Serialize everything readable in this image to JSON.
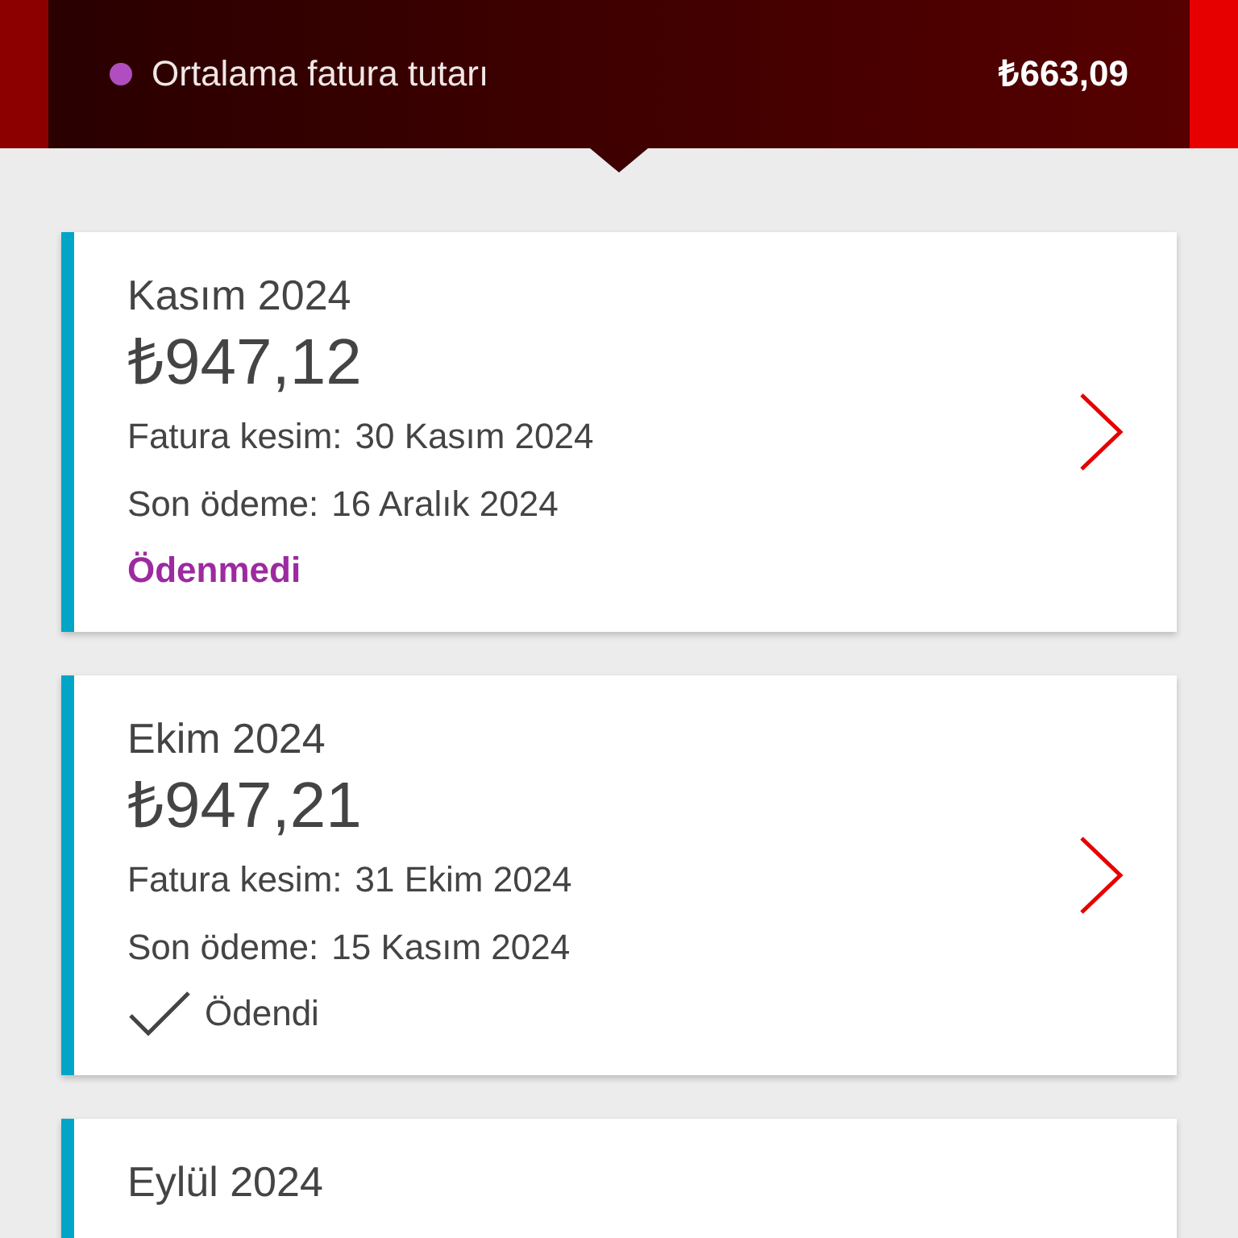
{
  "summary": {
    "legend": {
      "label": "Ortalama fatura tutarı",
      "color": "#b04ec0",
      "value": "₺663,09"
    }
  },
  "bills": [
    {
      "month": "Kasım 2024",
      "amount": "₺947,12",
      "issue_label": "Fatura kesim:",
      "issue_date": "30 Kasım 2024",
      "due_label": "Son ödeme:",
      "due_date": "16 Aralık 2024",
      "status": {
        "kind": "unpaid",
        "label": "Ödenmedi"
      }
    },
    {
      "month": "Ekim 2024",
      "amount": "₺947,21",
      "issue_label": "Fatura kesim:",
      "issue_date": "31 Ekim 2024",
      "due_label": "Son ödeme:",
      "due_date": "15 Kasım 2024",
      "status": {
        "kind": "paid",
        "label": "Ödendi"
      }
    },
    {
      "month": "Eylül 2024"
    }
  ]
}
